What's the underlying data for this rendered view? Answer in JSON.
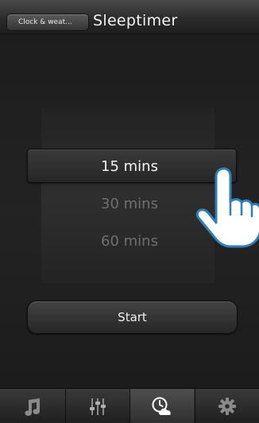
{
  "header": {
    "back_label": "Clock & weat...",
    "title": "Sleeptimer"
  },
  "picker": {
    "options": [
      "15 mins",
      "30 mins",
      "60 mins"
    ],
    "selected": "15 mins"
  },
  "actions": {
    "start_label": "Start"
  },
  "tabbar": {
    "tabs": [
      {
        "icon": "music-note-icon",
        "active": false
      },
      {
        "icon": "equalizer-icon",
        "active": false
      },
      {
        "icon": "clock-weather-icon",
        "active": true
      },
      {
        "icon": "gear-icon",
        "active": false
      }
    ]
  },
  "colors": {
    "selected_text": "#f3f3f3",
    "unselected_text": "#6f6f6f",
    "background": "#1b1b1b"
  }
}
